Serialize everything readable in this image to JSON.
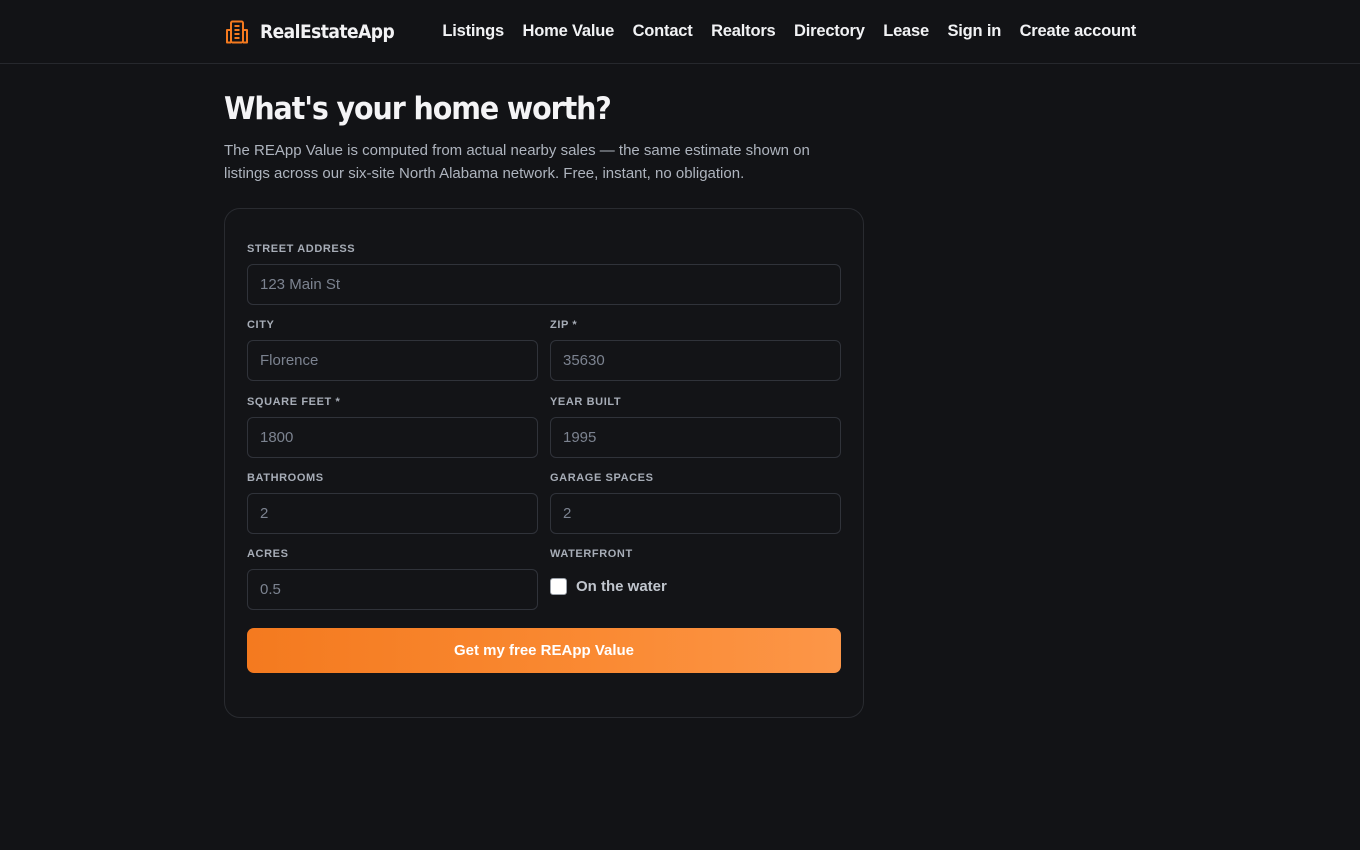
{
  "header": {
    "brand_name": "RealEstateApp",
    "brand_icon": "building-icon",
    "accent_color": "#f47a1f",
    "nav": [
      {
        "label": "Listings"
      },
      {
        "label": "Home Value"
      },
      {
        "label": "Contact"
      },
      {
        "label": "Realtors"
      },
      {
        "label": "Directory"
      },
      {
        "label": "Lease"
      },
      {
        "label": "Sign in"
      },
      {
        "label": "Create account"
      }
    ]
  },
  "main": {
    "title": "What's your home worth?",
    "intro": "The REApp Value is computed from actual nearby sales — the same estimate shown on listings across our six-site North Alabama network. Free, instant, no obligation.",
    "form": {
      "street": {
        "label": "Street address",
        "placeholder": "123 Main St",
        "value": ""
      },
      "city": {
        "label": "City",
        "placeholder": "Florence",
        "value": ""
      },
      "zip": {
        "label": "Zip *",
        "placeholder": "35630",
        "value": ""
      },
      "sqft": {
        "label": "Square feet *",
        "placeholder": "1800",
        "value": ""
      },
      "year_built": {
        "label": "Year built",
        "placeholder": "1995",
        "value": ""
      },
      "bathrooms": {
        "label": "Bathrooms",
        "placeholder": "2",
        "value": ""
      },
      "garage": {
        "label": "Garage spaces",
        "placeholder": "2",
        "value": ""
      },
      "acres": {
        "label": "Acres",
        "placeholder": "0.5",
        "value": ""
      },
      "waterfront": {
        "label": "Waterfront",
        "checkbox_label": "On the water",
        "checked": false
      },
      "submit_label": "Get my free REApp Value"
    }
  }
}
